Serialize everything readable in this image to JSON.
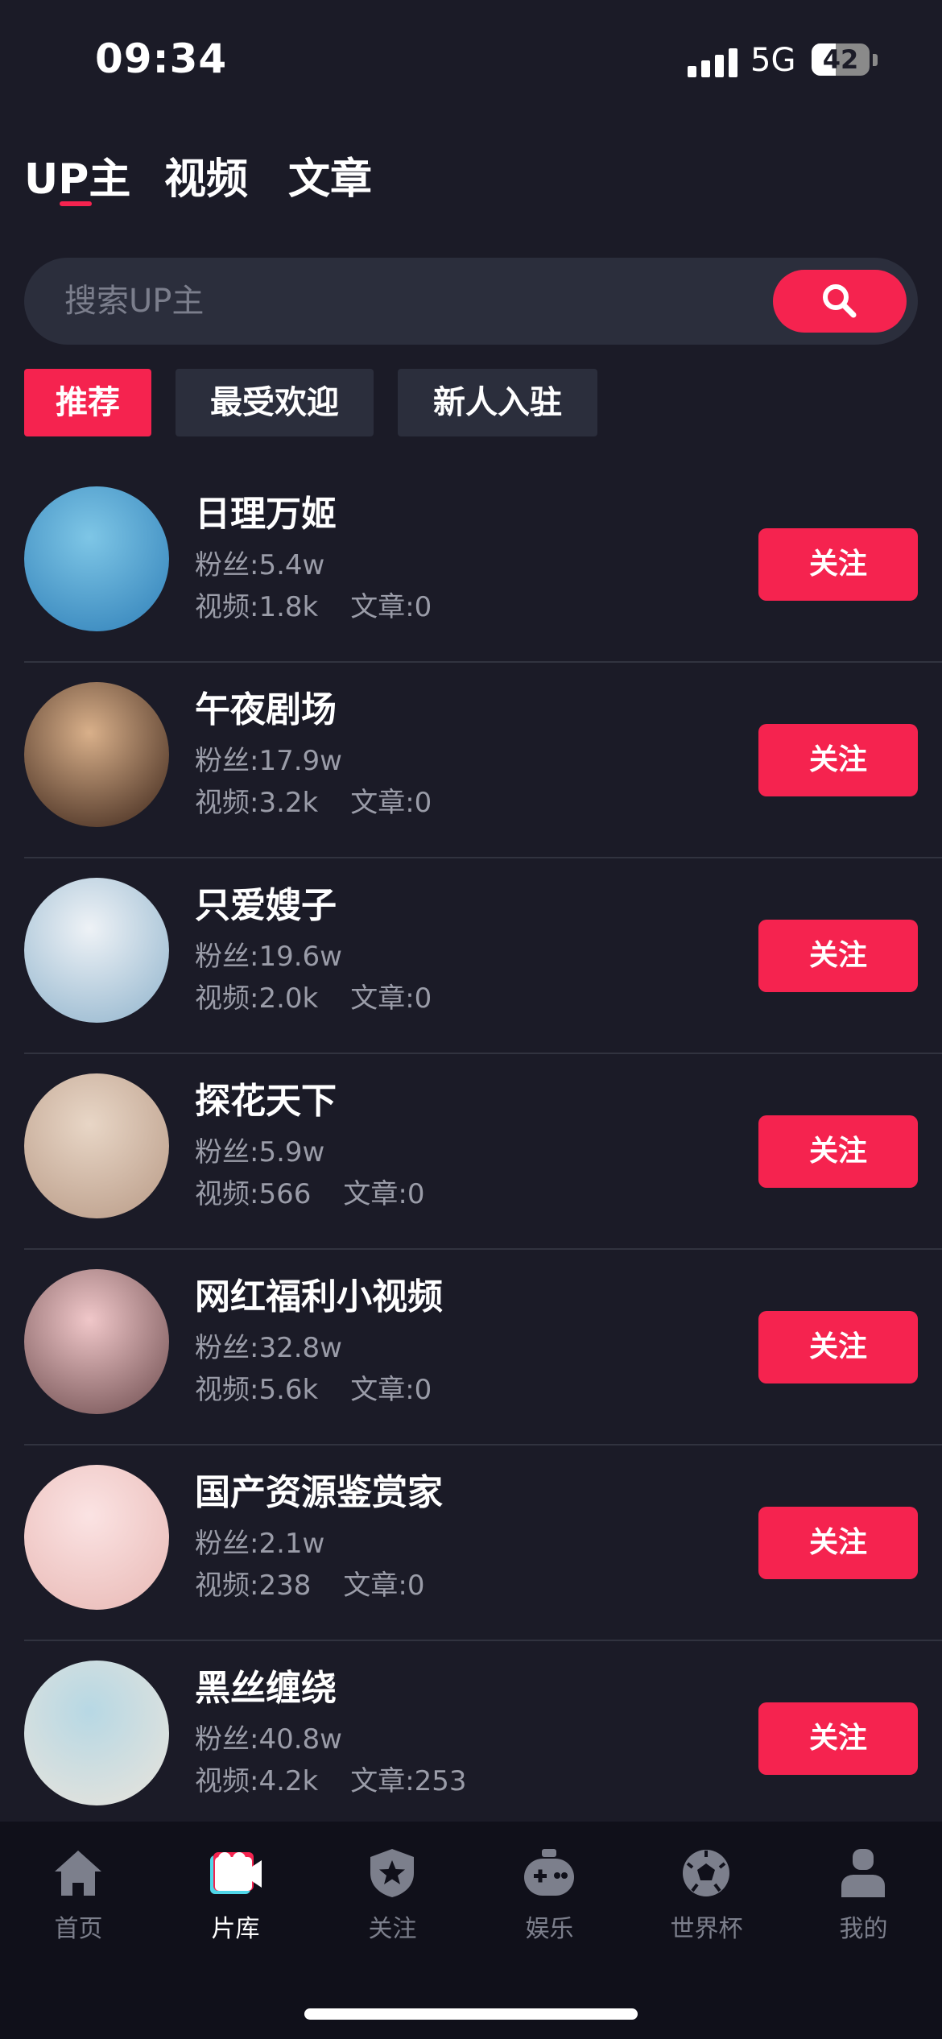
{
  "status_bar": {
    "time": "09:34",
    "network": "5G",
    "battery": "42",
    "battery_level": 0.42
  },
  "top_tabs": [
    {
      "label": "UP主",
      "active": true
    },
    {
      "label": "视频",
      "active": false
    },
    {
      "label": "文章",
      "active": false
    }
  ],
  "search": {
    "placeholder": "搜索UP主",
    "value": "",
    "icon": "search-icon"
  },
  "filters": [
    {
      "label": "推荐",
      "active": true
    },
    {
      "label": "最受欢迎",
      "active": false
    },
    {
      "label": "新人入驻",
      "active": false
    }
  ],
  "list": {
    "follow_label": "关注",
    "items": [
      {
        "name": "日理万姬",
        "fans": "粉丝:5.4w",
        "videos": "视频:1.8k",
        "articles": "文章:0",
        "avatar_colors": [
          "#7ec6e6",
          "#2f7fb8"
        ]
      },
      {
        "name": "午夜剧场",
        "fans": "粉丝:17.9w",
        "videos": "视频:3.2k",
        "articles": "文章:0",
        "avatar_colors": [
          "#d9b08a",
          "#3a2318"
        ]
      },
      {
        "name": "只爱嫂子",
        "fans": "粉丝:19.6w",
        "videos": "视频:2.0k",
        "articles": "文章:0",
        "avatar_colors": [
          "#eef2f6",
          "#8fb3cc"
        ]
      },
      {
        "name": "探花天下",
        "fans": "粉丝:5.9w",
        "videos": "视频:566",
        "articles": "文章:0",
        "avatar_colors": [
          "#e8d6c6",
          "#b89a86"
        ]
      },
      {
        "name": "网红福利小视频",
        "fans": "粉丝:32.8w",
        "videos": "视频:5.6k",
        "articles": "文章:0",
        "avatar_colors": [
          "#f0c7c9",
          "#6b4a4c"
        ]
      },
      {
        "name": "国产资源鉴赏家",
        "fans": "粉丝:2.1w",
        "videos": "视频:238",
        "articles": "文章:0",
        "avatar_colors": [
          "#fbe3e3",
          "#e8b8b4"
        ]
      },
      {
        "name": "黑丝缠绕",
        "fans": "粉丝:40.8w",
        "videos": "视频:4.2k",
        "articles": "文章:253",
        "avatar_colors": [
          "#b7d8e4",
          "#e9e4dc"
        ]
      }
    ]
  },
  "bottom_nav": [
    {
      "label": "首页",
      "icon": "home-icon",
      "active": false
    },
    {
      "label": "片库",
      "icon": "video-library-icon",
      "active": true
    },
    {
      "label": "关注",
      "icon": "star-shield-icon",
      "active": false
    },
    {
      "label": "娱乐",
      "icon": "gamepad-icon",
      "active": false
    },
    {
      "label": "世界杯",
      "icon": "soccer-ball-icon",
      "active": false
    },
    {
      "label": "我的",
      "icon": "user-icon",
      "active": false
    }
  ],
  "colors": {
    "accent": "#f5234f",
    "background": "#1b1b27",
    "surface": "#2b2e3c",
    "muted_text": "#9a9ca8"
  }
}
